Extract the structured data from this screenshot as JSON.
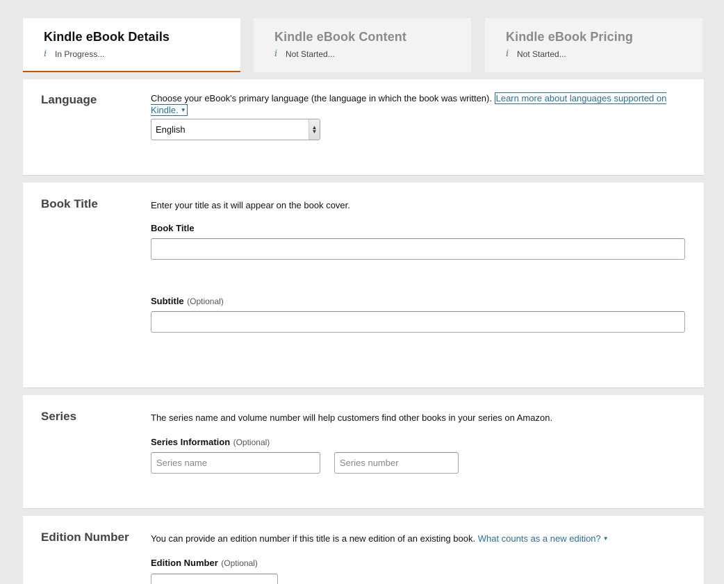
{
  "tabs": [
    {
      "title": "Kindle eBook Details",
      "status": "In Progress..."
    },
    {
      "title": "Kindle eBook Content",
      "status": "Not Started..."
    },
    {
      "title": "Kindle eBook Pricing",
      "status": "Not Started..."
    }
  ],
  "info_icon": "i",
  "language": {
    "title": "Language",
    "description": "Choose your eBook's primary language (the language in which the book was written).",
    "link": "Learn more about languages supported on Kindle.",
    "selected": "English"
  },
  "book_title": {
    "title": "Book Title",
    "description": "Enter your title as it will appear on the book cover.",
    "title_label": "Book Title",
    "title_value": "",
    "subtitle_label": "Subtitle",
    "subtitle_optional": "(Optional)",
    "subtitle_value": ""
  },
  "series": {
    "title": "Series",
    "description": "The series name and volume number will help customers find other books in your series on Amazon.",
    "label": "Series Information",
    "optional": "(Optional)",
    "name_placeholder": "Series name",
    "number_placeholder": "Series number"
  },
  "edition": {
    "title": "Edition Number",
    "description": "You can provide an edition number if this title is a new edition of an existing book.",
    "link": "What counts as a new edition?",
    "label": "Edition Number",
    "optional": "(Optional)"
  },
  "colors": {
    "active_tab_underline": "#c45500",
    "link": "#2c6f95",
    "page_bg": "#e9e9e9"
  }
}
